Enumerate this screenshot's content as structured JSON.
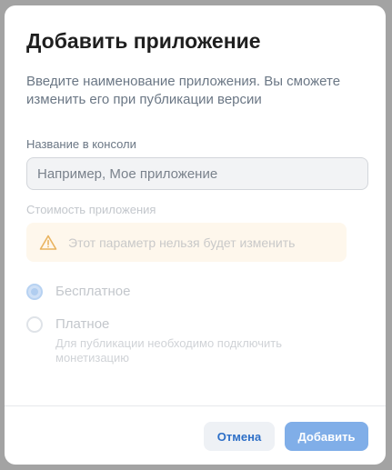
{
  "dialog": {
    "title": "Добавить приложение",
    "description": "Введите наименование приложения. Вы сможете изменить его при публикации версии"
  },
  "name_field": {
    "label": "Название в консоли",
    "placeholder": "Например, Мое приложение",
    "value": ""
  },
  "cost": {
    "label": "Стоимость приложения",
    "warning_icon": "warning-triangle-icon",
    "warning_text": "Этот параметр нельзя будет изменить",
    "options": [
      {
        "label": "Бесплатное",
        "sublabel": "",
        "checked": true
      },
      {
        "label": "Платное",
        "sublabel": "Для публикации необходимо подключить монетизацию",
        "checked": false
      }
    ]
  },
  "footer": {
    "cancel_label": "Отмена",
    "add_label": "Добавить"
  },
  "colors": {
    "accent": "#2d6fc7",
    "primary_button": "#80aee8",
    "warning_background": "#fef7ec",
    "warning_icon": "#e9b35f"
  }
}
